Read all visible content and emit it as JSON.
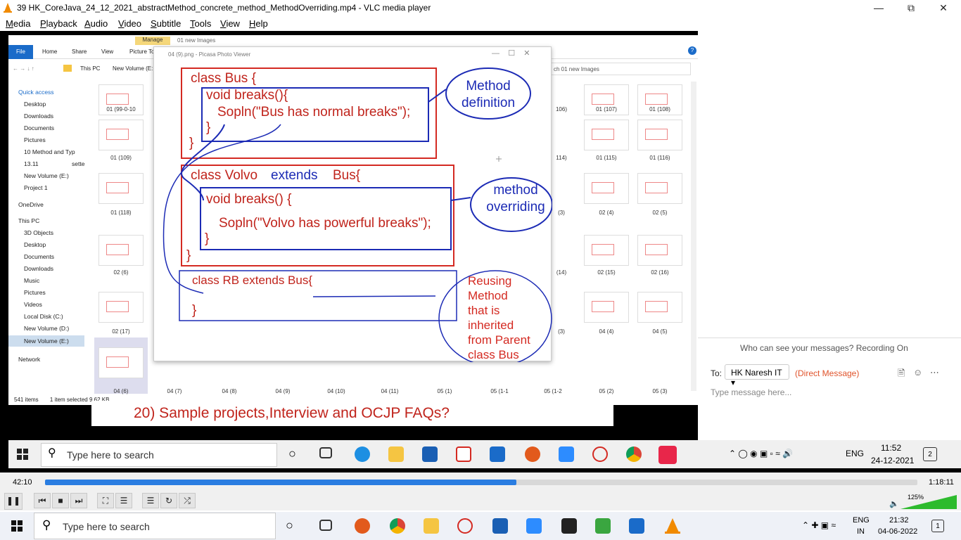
{
  "window": {
    "title": "39 HK_CoreJava_24_12_2021_abstractMethod_concrete_method_MethodOverriding.mp4 - VLC media player"
  },
  "menu": [
    "Media",
    "Playback",
    "Audio",
    "Video",
    "Subtitle",
    "Tools",
    "View",
    "Help"
  ],
  "explorer": {
    "ribbon_tabs": [
      "File",
      "Home",
      "Share",
      "View",
      "Picture To"
    ],
    "manage": "Manage",
    "context_title": "01 new Images",
    "path_this_pc": "This PC",
    "path_volume": "New Volume (E:",
    "search_text": "ch 01 new Images",
    "nav_items": [
      "Quick access",
      "Desktop",
      "Downloads",
      "Documents",
      "Pictures",
      "10 Method and Typ",
      "13.11",
      "New Volume (E:)",
      "Project 1",
      "OneDrive",
      "This PC",
      "3D Objects",
      "Desktop",
      "Documents",
      "Downloads",
      "Music",
      "Pictures",
      "Videos",
      "Local Disk (C:)",
      "New Volume (D:)",
      "New Volume (E:)",
      "Network"
    ],
    "sette": "sette",
    "thumbs_left": [
      "01 (99-0-10",
      "01 (109)",
      "01 (118)",
      "02 (6)",
      "02 (17)",
      "04 (6)"
    ],
    "thumbs_right_col1": [
      "106)",
      "114)",
      "(3)",
      "(14)",
      "(3)"
    ],
    "thumbs_right_col2": [
      "01 (107)",
      "01 (115)",
      "02 (4)",
      "02 (15)",
      "04 (4)"
    ],
    "thumbs_right_col3": [
      "01 (108)",
      "01 (116)",
      "02 (5)",
      "02 (16)",
      "04 (5)"
    ],
    "bottom_row": [
      "04 (7)",
      "04 (8)",
      "04 (9)",
      "04 (10)",
      "04 (11)",
      "05 (1)",
      "05 (1-1",
      "05 (1-2",
      "05 (2)",
      "05 (3)"
    ],
    "status_items": "541 items",
    "status_selected": "1 item selected  9.62 KB"
  },
  "picasa": {
    "title": "04 (9).png - Picasa Photo Viewer",
    "code": {
      "class_bus": "class Bus {",
      "void_breaks": "void breaks(){",
      "sopln_bus": "Sopln(\"Bus has normal breaks\");",
      "close1": "}",
      "close2": "}",
      "class_volvo_1": "class Volvo",
      "class_volvo_2": "extends",
      "class_volvo_3": "Bus{",
      "void_breaks2": "void breaks() {",
      "sopln_volvo": "Sopln(\"Volvo has powerful breaks\");",
      "close3": "}",
      "close4": "}",
      "class_rb": "class RB extends Bus{",
      "close5": "}"
    },
    "notes": {
      "method_def_1": "Method",
      "method_def_2": "definition",
      "override_1": "method",
      "override_2": "overriding",
      "reuse": [
        "Reusing",
        "Method",
        "that is",
        "inherited",
        "from Parent",
        "class Bus"
      ]
    }
  },
  "caption": "20) Sample projects,Interview and OCJP FAQs?",
  "teams": {
    "who_can_see": "Who can see your messages? Recording On",
    "to_label": "To:",
    "recipient": "HK Naresh IT",
    "dm": "(Direct Message)",
    "placeholder": "Type message here..."
  },
  "inner_taskbar": {
    "search": "Type here to search",
    "lang": "ENG",
    "time": "11:52",
    "date": "24-12-2021",
    "notif": "2"
  },
  "player": {
    "elapsed": "42:10",
    "total": "1:18:11",
    "progress": 0.54,
    "volume": "125%"
  },
  "outer_taskbar": {
    "search": "Type here to search",
    "lang1": "ENG",
    "lang2": "IN",
    "time": "21:32",
    "date": "04-06-2022",
    "notif": "1"
  }
}
